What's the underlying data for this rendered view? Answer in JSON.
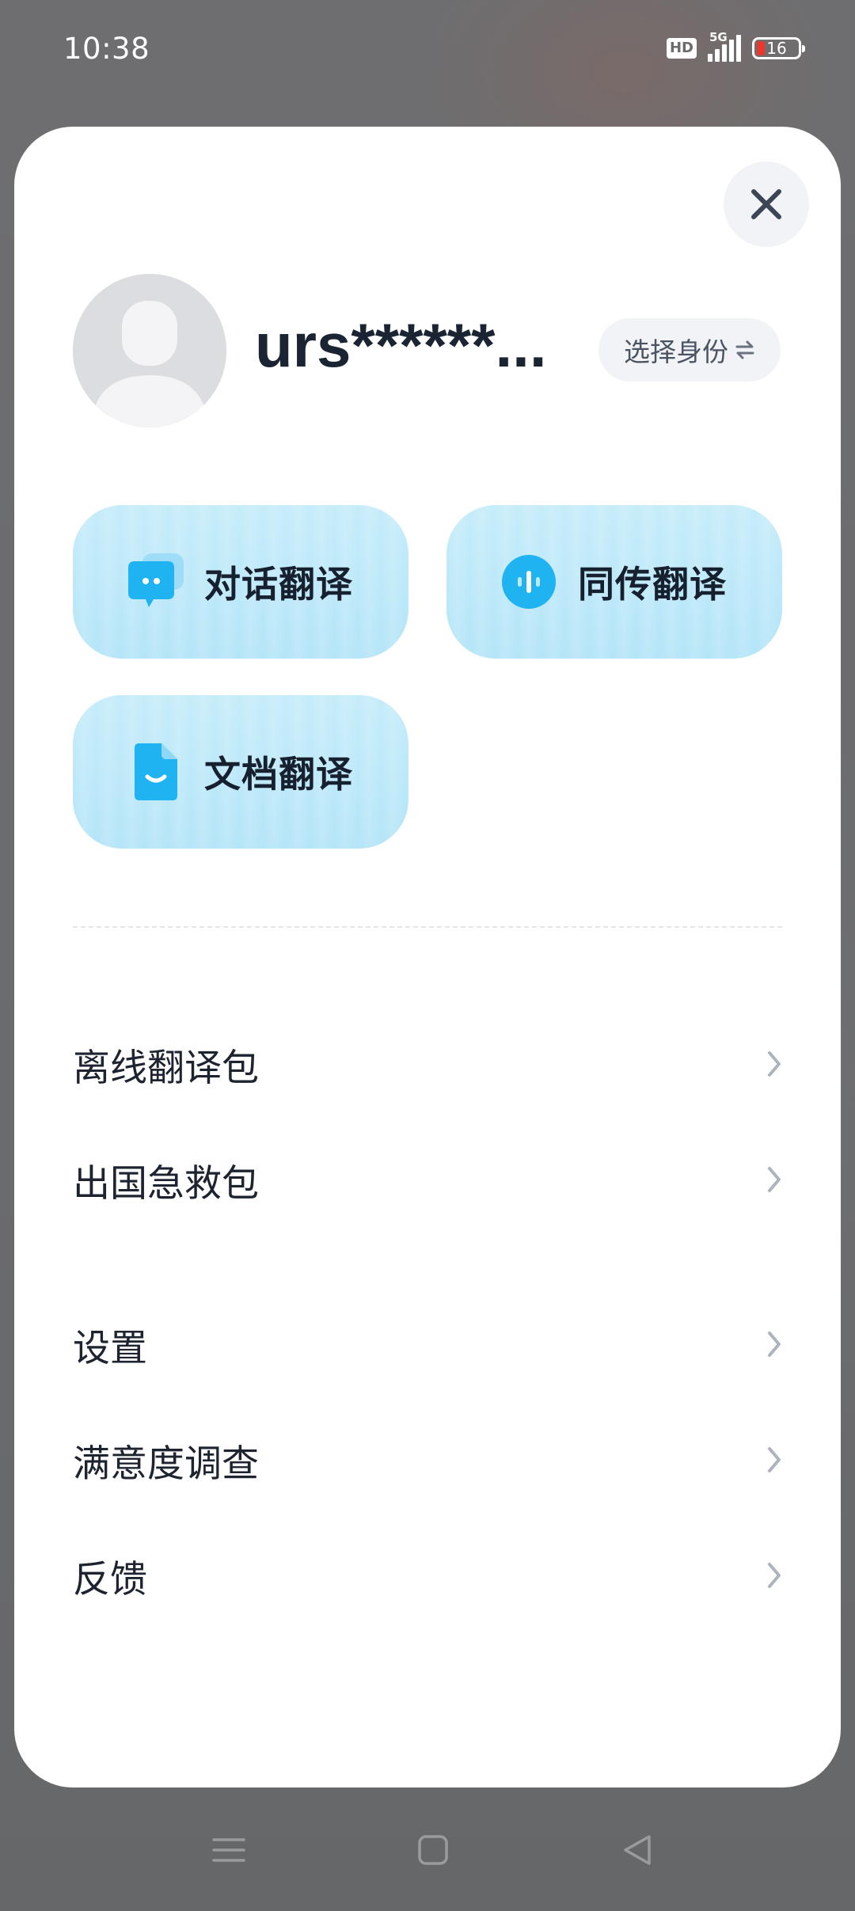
{
  "status_bar": {
    "time": "10:38",
    "hd": "HD",
    "network": "5G",
    "battery": "16"
  },
  "profile": {
    "username": "urs******...",
    "role_button": "选择身份"
  },
  "features": [
    {
      "label": "对话翻译",
      "icon": "chat-bubble-icon"
    },
    {
      "label": "同传翻译",
      "icon": "audio-wave-icon"
    },
    {
      "label": "文档翻译",
      "icon": "document-icon"
    }
  ],
  "menu": {
    "group1": [
      {
        "label": "离线翻译包"
      },
      {
        "label": "出国急救包"
      }
    ],
    "group2": [
      {
        "label": "设置"
      },
      {
        "label": "满意度调查"
      },
      {
        "label": "反馈"
      }
    ]
  },
  "colors": {
    "accent": "#1fb2f2",
    "feature_card": "#c2ebfa",
    "battery_low": "#e8392c"
  }
}
